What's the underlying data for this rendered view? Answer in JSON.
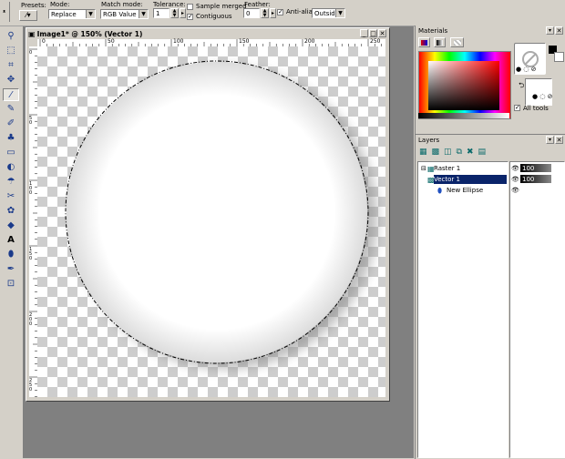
{
  "toolbar": {
    "presets_label": "Presets:",
    "mode_label": "Mode:",
    "mode_value": "Replace",
    "match_mode_label": "Match mode:",
    "match_mode_value": "RGB Value",
    "tolerance_label": "Tolerance:",
    "tolerance_value": "1",
    "sample_merged_label": "Sample merged",
    "contiguous_label": "Contiguous",
    "feather_label": "Feather:",
    "feather_value": "0",
    "antialias_label": "Anti-alias",
    "antialias_value": "Outside"
  },
  "document": {
    "title": "Image1* @ 150% (Vector 1)",
    "ruler_top": [
      "0",
      "50",
      "100",
      "150",
      "200",
      "250"
    ],
    "ruler_left": [
      "0",
      "50",
      "100",
      "150",
      "200",
      "250"
    ]
  },
  "materials": {
    "title": "Materials",
    "all_tools_label": "All tools"
  },
  "layers": {
    "title": "Layers",
    "items": [
      {
        "name": "Raster 1",
        "opacity": "100"
      },
      {
        "name": "Vector 1",
        "opacity": "100"
      },
      {
        "name": "New Ellipse"
      }
    ]
  },
  "colors": {
    "selection_bg": "#0a246a",
    "ui_bg": "#d4d0c8",
    "workspace": "#808080"
  }
}
